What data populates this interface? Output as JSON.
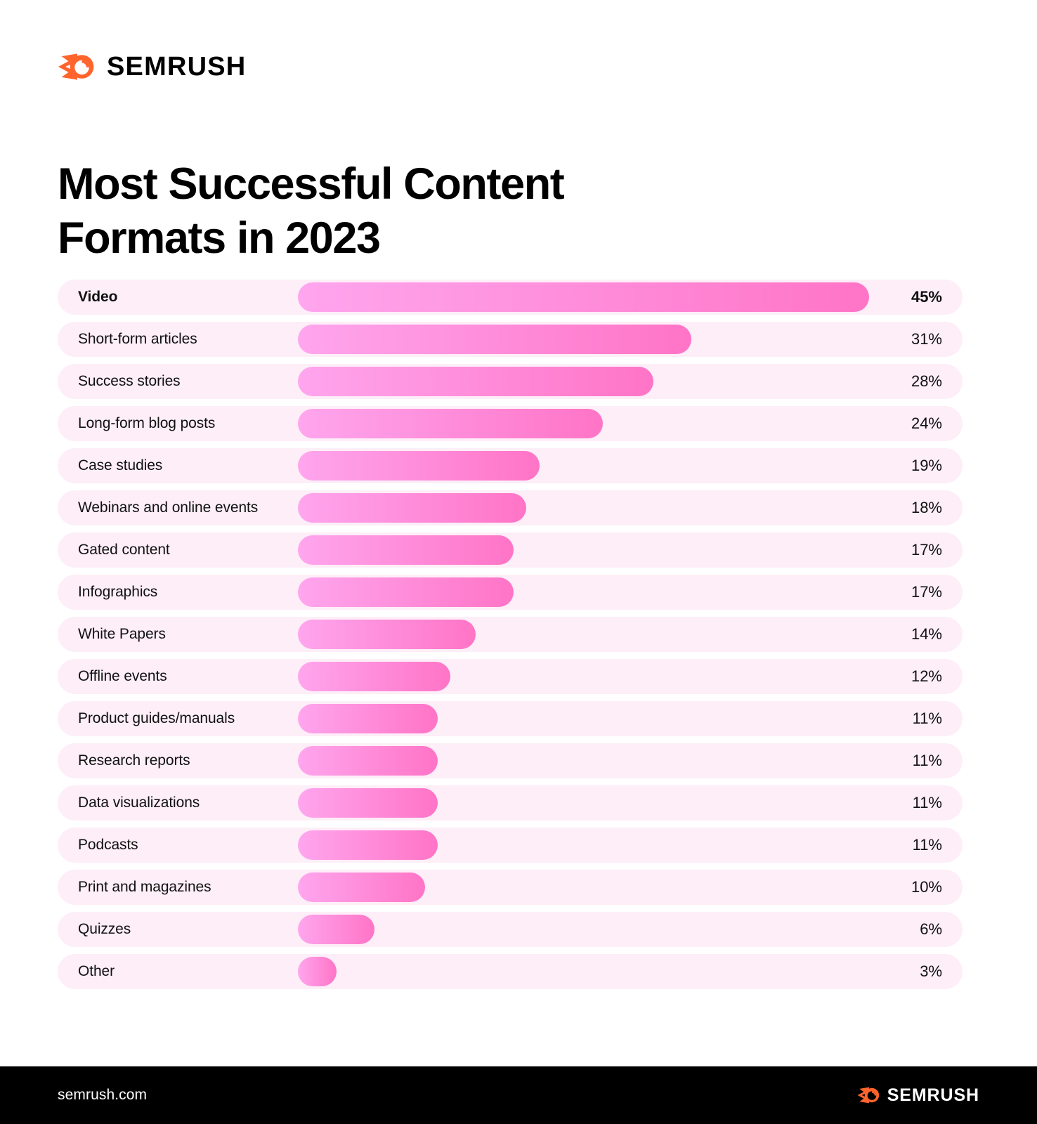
{
  "brand": {
    "logo_icon": "semrush-comet-icon",
    "wordmark": "SEMRUSH",
    "accent_color": "#FF642D"
  },
  "title": "Most Successful Content\nFormats in 2023",
  "footer": {
    "url": "semrush.com",
    "logo_icon": "semrush-comet-icon",
    "wordmark": "SEMRUSH",
    "background_color": "#000000"
  },
  "colors": {
    "row_track": "#FDEEF8",
    "bar_gradient_start": "#FFA6EE",
    "bar_gradient_end": "#FF74C6",
    "text": "#111111",
    "page_background": "#FFFFFF"
  },
  "chart_data": {
    "type": "bar",
    "orientation": "horizontal",
    "title": "Most Successful Content Formats in 2023",
    "xlabel": "",
    "ylabel": "",
    "xlim": [
      0,
      45
    ],
    "grid": false,
    "legend": "none",
    "value_suffix": "%",
    "categories": [
      "Video",
      "Short-form articles",
      "Success stories",
      "Long-form blog posts",
      "Case studies",
      "Webinars and online events",
      "Gated content",
      "Infographics",
      "White Papers",
      "Offline events",
      "Product guides/manuals",
      "Research reports",
      "Data visualizations",
      "Podcasts",
      "Print and magazines",
      "Quizzes",
      "Other"
    ],
    "values": [
      45,
      31,
      28,
      24,
      19,
      18,
      17,
      17,
      14,
      12,
      11,
      11,
      11,
      11,
      10,
      6,
      3
    ],
    "value_labels": [
      "45%",
      "31%",
      "28%",
      "24%",
      "19%",
      "18%",
      "17%",
      "17%",
      "14%",
      "12%",
      "11%",
      "11%",
      "11%",
      "11%",
      "10%",
      "6%",
      "3%"
    ],
    "highlighted_index": 0
  }
}
